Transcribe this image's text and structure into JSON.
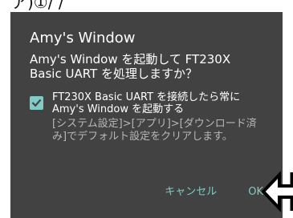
{
  "page": {
    "top_cut_text": "ア)①/ /"
  },
  "dialog": {
    "title": "Amy's Window",
    "message": "Amy's Window を起動して FT230X Basic UART を処理しますか？",
    "checkbox": {
      "checked": true,
      "label": "FT230X Basic UART を接続したら常に Amy's Window を起動する",
      "help": "[システム設定]>[アプリ]>[ダウンロード済み]でデフォルト設定をクリアします。"
    },
    "buttons": {
      "cancel_label": "キャンセル",
      "ok_label": "OK"
    }
  },
  "annotation": {
    "icon": "pointer-arrow-icon",
    "color": "#000000"
  },
  "colors": {
    "dialog_background": "#424242",
    "accent": "#80cbc4",
    "help_text": "#b7b7b7"
  }
}
